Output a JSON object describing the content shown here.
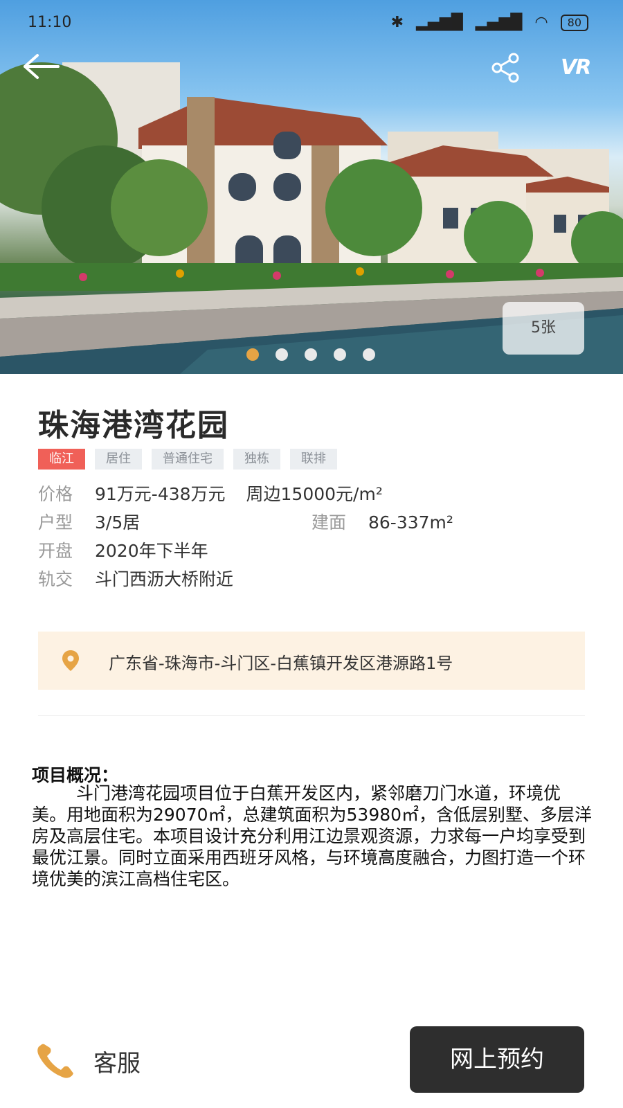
{
  "status_bar": {
    "time": "11:10",
    "battery": "80"
  },
  "hero": {
    "photo_count": "5张",
    "vr_label": "VR",
    "dots": 5,
    "active_dot": 0
  },
  "property": {
    "name": "珠海港湾花园",
    "tags": [
      "临江",
      "居住",
      "普通住宅",
      "独栋",
      "联排"
    ],
    "price_label": "价格",
    "price_value": "91万元-438万元",
    "surround_price": "周边15000元/m²",
    "layout_label": "户型",
    "layout_value": "3/5居",
    "area_label": "建面",
    "area_value": "86-337m²",
    "open_label": "开盘",
    "open_value": "2020年下半年",
    "transit_label": "轨交",
    "transit_value": "斗门西沥大桥附近",
    "address": "广东省-珠海市-斗门区-白蕉镇开发区港源路1号"
  },
  "overview": {
    "title": "项目概况：",
    "body": "斗门港湾花园项目位于白蕉开发区内，紧邻磨刀门水道，环境优美。用地面积为29070㎡，总建筑面积为53980㎡，含低层别墅、多层洋房及高层住宅。本项目设计充分利用江边景观资源，力求每一户均享受到最优江景。同时立面采用西班牙风格，与环境高度融合，力图打造一个环境优美的滨江高档住宅区。"
  },
  "bottom_bar": {
    "service_label": "客服",
    "book_label": "网上预约"
  },
  "colors": {
    "accent": "#e6a445",
    "tag_highlight": "#f06058",
    "address_bg": "#fdf2e3",
    "button_dark": "#2e2e2e"
  }
}
